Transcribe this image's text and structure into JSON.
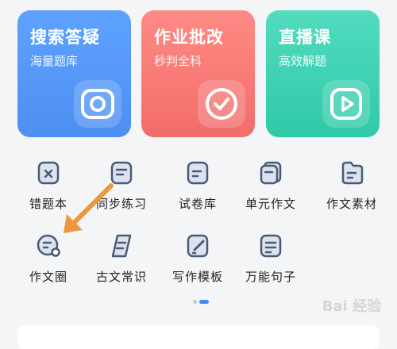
{
  "cards": [
    {
      "title": "搜索答疑",
      "subtitle": "海量题库",
      "icon": "camera-icon"
    },
    {
      "title": "作业批改",
      "subtitle": "秒判全科",
      "icon": "check-icon"
    },
    {
      "title": "直播课",
      "subtitle": "高效解题",
      "icon": "play-icon"
    }
  ],
  "grid": [
    {
      "label": "错题本",
      "icon": "wrong-question-icon"
    },
    {
      "label": "同步练习",
      "icon": "practice-icon"
    },
    {
      "label": "试卷库",
      "icon": "paper-library-icon"
    },
    {
      "label": "单元作文",
      "icon": "unit-essay-icon"
    },
    {
      "label": "作文素材",
      "icon": "essay-material-icon"
    },
    {
      "label": "作文圈",
      "icon": "essay-circle-icon"
    },
    {
      "label": "古文常识",
      "icon": "classical-chinese-icon"
    },
    {
      "label": "写作模板",
      "icon": "writing-template-icon"
    },
    {
      "label": "万能句子",
      "icon": "sentence-icon"
    }
  ],
  "colors": {
    "blue": "#4d8ff2",
    "red": "#f26d6a",
    "green": "#2fc9a8",
    "icon_stroke": "#4a5a75",
    "arrow": "#f0963a"
  },
  "watermark": "Bai 经验"
}
